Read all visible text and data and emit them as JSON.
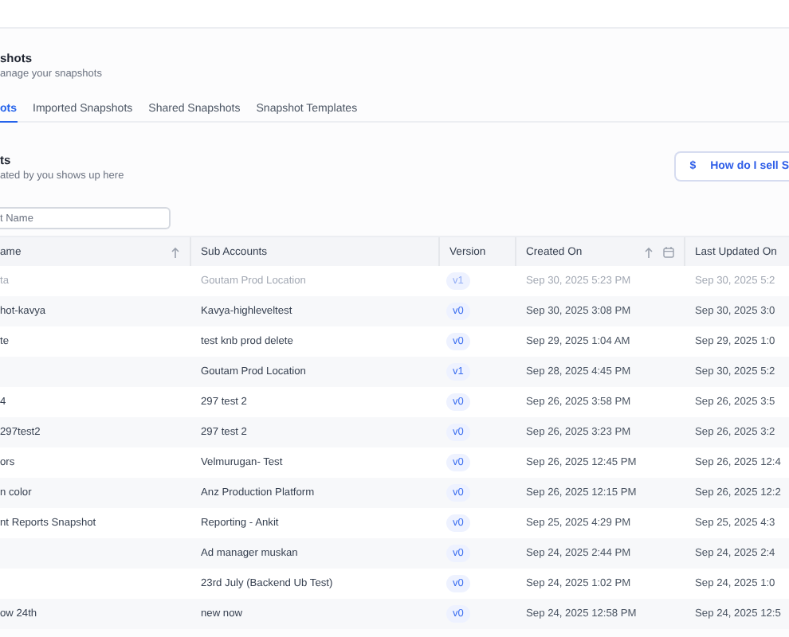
{
  "page": {
    "title": "shots",
    "subtitle": "anage your snapshots"
  },
  "tabs": [
    {
      "label": "ots",
      "selected": true
    },
    {
      "label": "Imported Snapshots",
      "selected": false
    },
    {
      "label": "Shared Snapshots",
      "selected": false
    },
    {
      "label": "Snapshot Templates",
      "selected": false
    }
  ],
  "section": {
    "title": "ts",
    "subtitle": "ated by you shows up here"
  },
  "help_button": {
    "icon": "$",
    "label": "How do I sell S"
  },
  "search": {
    "placeholder": "t Name"
  },
  "table": {
    "columns": [
      {
        "label": "ame",
        "sortable": true
      },
      {
        "label": "Sub Accounts",
        "sortable": false
      },
      {
        "label": "Version",
        "sortable": false
      },
      {
        "label": "Created On",
        "sortable": true,
        "date_filter": true
      },
      {
        "label": "Last Updated On",
        "sortable": false
      }
    ],
    "rows": [
      {
        "name": "ta",
        "sub_account": "Goutam Prod Location",
        "version": "v1",
        "created": "Sep 30, 2025 5:23 PM",
        "updated": "Sep 30, 2025 5:2",
        "muted": true
      },
      {
        "name": "hot-kavya",
        "sub_account": "Kavya-highleveltest",
        "version": "v0",
        "created": "Sep 30, 2025 3:08 PM",
        "updated": "Sep 30, 2025 3:0",
        "muted": false
      },
      {
        "name": "te",
        "sub_account": "test knb prod delete",
        "version": "v0",
        "created": "Sep 29, 2025 1:04 AM",
        "updated": "Sep 29, 2025 1:0",
        "muted": false
      },
      {
        "sub_account": "Goutam Prod Location",
        "version": "v1",
        "created": "Sep 28, 2025 4:45 PM",
        "updated": "Sep 30, 2025 5:2",
        "muted": false
      },
      {
        "name": "4",
        "sub_account": "297 test 2",
        "version": "v0",
        "created": "Sep 26, 2025 3:58 PM",
        "updated": "Sep 26, 2025 3:5",
        "muted": false
      },
      {
        "name": "297test2",
        "sub_account": "297 test 2",
        "version": "v0",
        "created": "Sep 26, 2025 3:23 PM",
        "updated": "Sep 26, 2025 3:2",
        "muted": false
      },
      {
        "name": "ors",
        "sub_account": "Velmurugan- Test",
        "version": "v0",
        "created": "Sep 26, 2025 12:45 PM",
        "updated": "Sep 26, 2025 12:4",
        "muted": false
      },
      {
        "name": "n color",
        "sub_account": "Anz Production Platform",
        "version": "v0",
        "created": "Sep 26, 2025 12:15 PM",
        "updated": "Sep 26, 2025 12:2",
        "muted": false
      },
      {
        "name": "nt Reports Snapshot",
        "sub_account": "Reporting - Ankit",
        "version": "v0",
        "created": "Sep 25, 2025 4:29 PM",
        "updated": "Sep 25, 2025 4:3",
        "muted": false
      },
      {
        "sub_account": "Ad manager muskan",
        "version": "v0",
        "created": "Sep 24, 2025 2:44 PM",
        "updated": "Sep 24, 2025 2:4",
        "muted": false
      },
      {
        "sub_account": "23rd July (Backend Ub Test)",
        "version": "v0",
        "created": "Sep 24, 2025 1:02 PM",
        "updated": "Sep 24, 2025 1:0",
        "muted": false
      },
      {
        "name": "ow 24th",
        "sub_account": "new now",
        "version": "v0",
        "created": "Sep 24, 2025 12:58 PM",
        "updated": "Sep 24, 2025 12:5",
        "muted": false
      }
    ]
  }
}
